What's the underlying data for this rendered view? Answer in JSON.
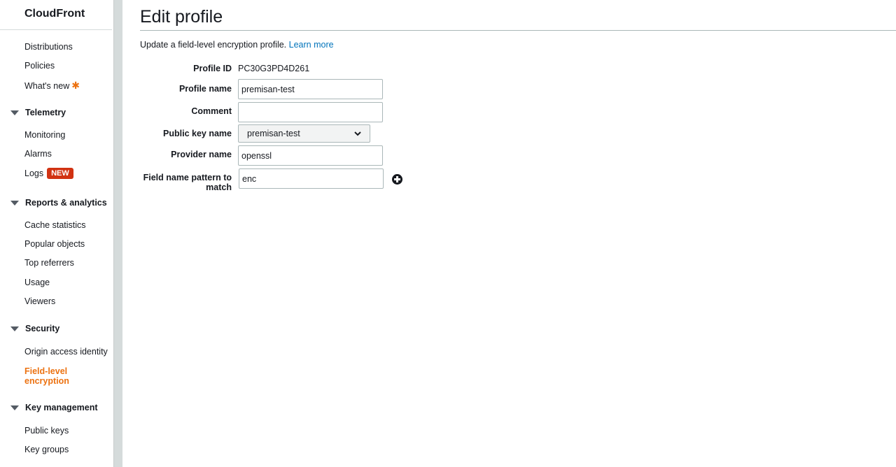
{
  "sidebar": {
    "title": "CloudFront",
    "top_items": [
      "Distributions",
      "Policies",
      "What's new"
    ],
    "whats_new_marker": "✱",
    "telemetry": {
      "heading": "Telemetry",
      "items": [
        "Monitoring",
        "Alarms",
        "Logs"
      ],
      "logs_badge": "NEW"
    },
    "reports": {
      "heading": "Reports & analytics",
      "items": [
        "Cache statistics",
        "Popular objects",
        "Top referrers",
        "Usage",
        "Viewers"
      ]
    },
    "security": {
      "heading": "Security",
      "items": [
        "Origin access identity",
        "Field-level encryption"
      ]
    },
    "key_management": {
      "heading": "Key management",
      "items": [
        "Public keys",
        "Key groups"
      ]
    }
  },
  "main": {
    "title": "Edit profile",
    "description": "Update a field-level encryption profile.",
    "learn_more": "Learn more",
    "fields": {
      "profile_id_label": "Profile ID",
      "profile_id_value": "PC30G3PD4D261",
      "profile_name_label": "Profile name",
      "profile_name_value": "premisan-test",
      "comment_label": "Comment",
      "comment_value": "",
      "public_key_label": "Public key name",
      "public_key_value": "premisan-test",
      "provider_label": "Provider name",
      "provider_value": "openssl",
      "pattern_label": "Field name pattern to match",
      "pattern_value": "enc"
    }
  },
  "colors": {
    "accent": "#ec7211",
    "link": "#0073bb",
    "badge": "#d13212"
  }
}
